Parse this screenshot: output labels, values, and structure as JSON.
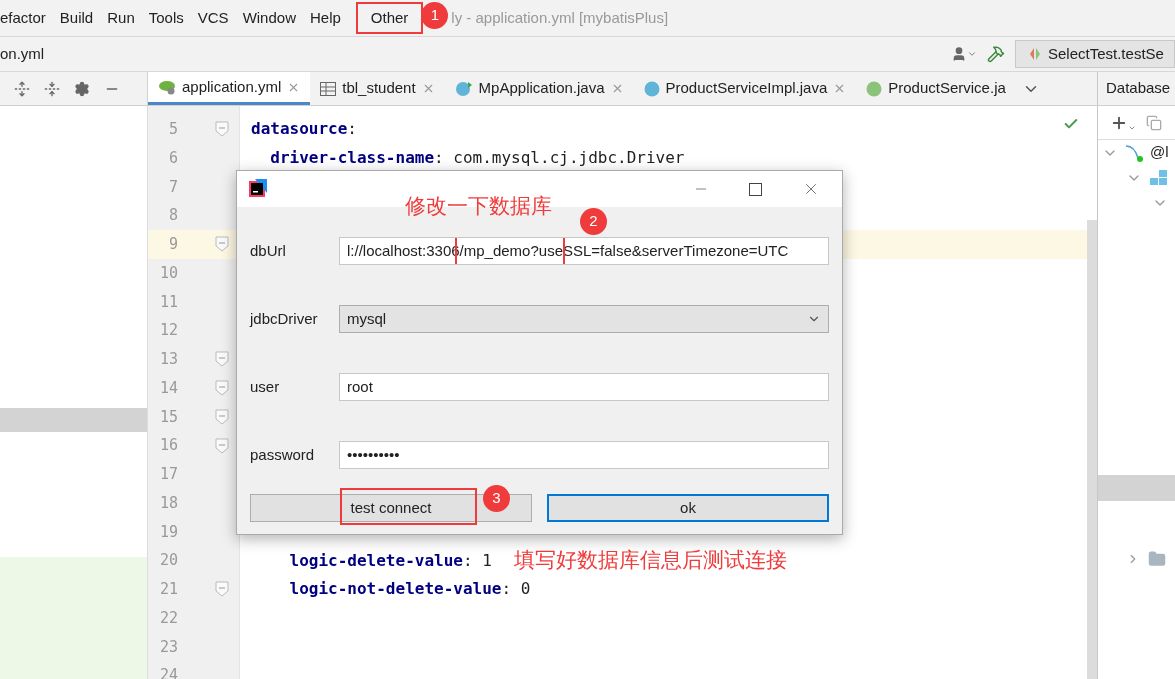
{
  "menu_bar": {
    "items": [
      {
        "label": "efactor",
        "highlighted": false
      },
      {
        "label": "Build",
        "highlighted": false
      },
      {
        "label": "Run",
        "highlighted": false
      },
      {
        "label": "Tools",
        "highlighted": false
      },
      {
        "label": "VCS",
        "highlighted": false
      },
      {
        "label": "Window",
        "highlighted": false
      },
      {
        "label": "Help",
        "highlighted": false
      },
      {
        "label": "Other",
        "highlighted": true
      }
    ],
    "badge": "1",
    "window_title": "ly - application.yml [mybatisPlus]"
  },
  "nav_bar": {
    "breadcrumb": "on.yml",
    "run_config": "SelectTest.testSe"
  },
  "editor_tabs": [
    {
      "label": "application.yml",
      "kind": "yaml",
      "selected": true,
      "closable": true
    },
    {
      "label": "tbl_student",
      "kind": "table",
      "selected": false,
      "closable": true
    },
    {
      "label": "MpApplication.java",
      "kind": "app",
      "selected": false,
      "closable": true
    },
    {
      "label": "ProductServiceImpl.java",
      "kind": "class",
      "selected": false,
      "closable": true
    },
    {
      "label": "ProductService.ja",
      "kind": "interface",
      "selected": false,
      "closable": false
    }
  ],
  "code": {
    "lines": [
      {
        "number": "5",
        "key": "datasource",
        "value": ":",
        "current": false,
        "fold": true
      },
      {
        "number": "6",
        "key": "  driver-class-name",
        "value": ": com.mysql.cj.jdbc.Driver",
        "current": false,
        "fold": false
      },
      {
        "number": "7",
        "current": false,
        "fold": false
      },
      {
        "number": "8",
        "current": false,
        "fold": false
      },
      {
        "number": "9",
        "current": true,
        "fold": true
      },
      {
        "number": "10",
        "current": false,
        "fold": false
      },
      {
        "number": "11",
        "current": false,
        "fold": false
      },
      {
        "number": "12",
        "current": false,
        "fold": false
      },
      {
        "number": "13",
        "current": false,
        "fold": true
      },
      {
        "number": "14",
        "current": false,
        "fold": true
      },
      {
        "number": "15",
        "current": false,
        "fold": true
      },
      {
        "number": "16",
        "current": false,
        "fold": true
      },
      {
        "number": "17",
        "current": false,
        "fold": false
      },
      {
        "number": "18",
        "current": false,
        "fold": false
      },
      {
        "number": "19",
        "current": false,
        "fold": false
      },
      {
        "number": "20",
        "key": "    logic-delete-value",
        "value": ": 1",
        "current": false,
        "fold": false,
        "note": "填写好数据库信息后测试连接"
      },
      {
        "number": "21",
        "key": "    logic-not-delete-value",
        "value": ": 0",
        "current": false,
        "fold": true
      },
      {
        "number": "22",
        "current": false,
        "fold": false
      },
      {
        "number": "23",
        "current": false,
        "fold": false
      },
      {
        "number": "24",
        "current": false,
        "fold": false
      }
    ]
  },
  "database_panel": {
    "title": "Database",
    "tree": [
      {
        "label": "@l",
        "expanded": true,
        "children": [
          {
            "kind": "schema",
            "expanded": true,
            "children": [
              {
                "kind": "group",
                "expanded": true
              }
            ]
          }
        ]
      },
      {
        "kind": "folder",
        "expanded": false
      }
    ]
  },
  "dialog": {
    "note": "修改一下数据库",
    "badge": "2",
    "fields": [
      {
        "label": "dbUrl",
        "kind": "text",
        "value": "l://localhost:3306/mp_demo?useSSL=false&serverTimezone=UTC"
      },
      {
        "label": "jdbcDriver",
        "kind": "select",
        "value": "mysql"
      },
      {
        "label": "user",
        "kind": "text",
        "value": "root"
      },
      {
        "label": "password",
        "kind": "text",
        "value": "••••••••••"
      }
    ],
    "buttons": [
      {
        "label": "test connect",
        "default": false,
        "framed": true,
        "badge": "3"
      },
      {
        "label": "ok",
        "default": true,
        "framed": false
      }
    ]
  }
}
